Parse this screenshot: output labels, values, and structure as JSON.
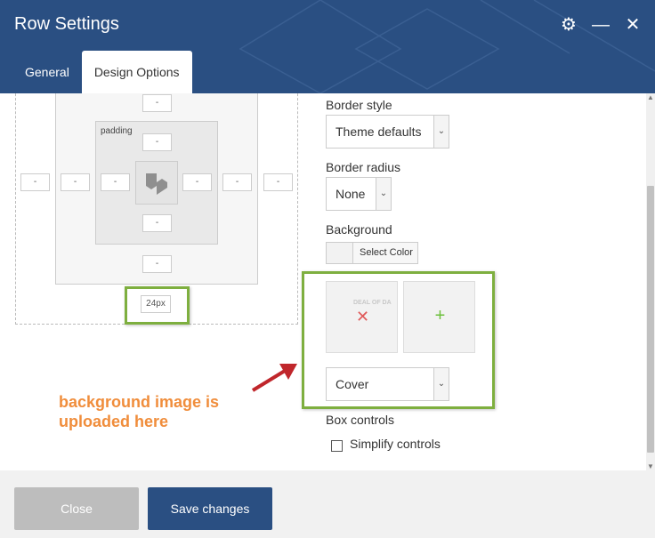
{
  "window": {
    "title": "Row Settings",
    "icons": [
      "gear-icon",
      "minimize-icon",
      "close-icon"
    ]
  },
  "tabs": [
    {
      "label": "General",
      "active": false
    },
    {
      "label": "Design Options",
      "active": true
    }
  ],
  "box_model": {
    "padding_label": "padding",
    "margin_bottom_value": "24px",
    "empty_value": "-"
  },
  "fields": {
    "border_style": {
      "label": "Border style",
      "value": "Theme defaults"
    },
    "border_radius": {
      "label": "Border radius",
      "value": "None"
    },
    "background": {
      "label": "Background",
      "select_color_label": "Select Color",
      "image_thumbnail_text": "DEAL OF DA",
      "image_size": "Cover"
    },
    "box_controls": {
      "label": "Box controls",
      "simplify_label": "Simplify controls",
      "simplify_checked": false
    }
  },
  "annotation": {
    "line1": "background image is",
    "line2": "uploaded here",
    "color": "#f08d3b",
    "highlight_color": "#7eaf3f",
    "arrow_color": "#c0262b"
  },
  "footer": {
    "close_label": "Close",
    "save_label": "Save changes"
  },
  "colors": {
    "header_bg": "#2a4f82",
    "save_bg": "#2a4f82",
    "close_bg": "#bdbdbd"
  }
}
